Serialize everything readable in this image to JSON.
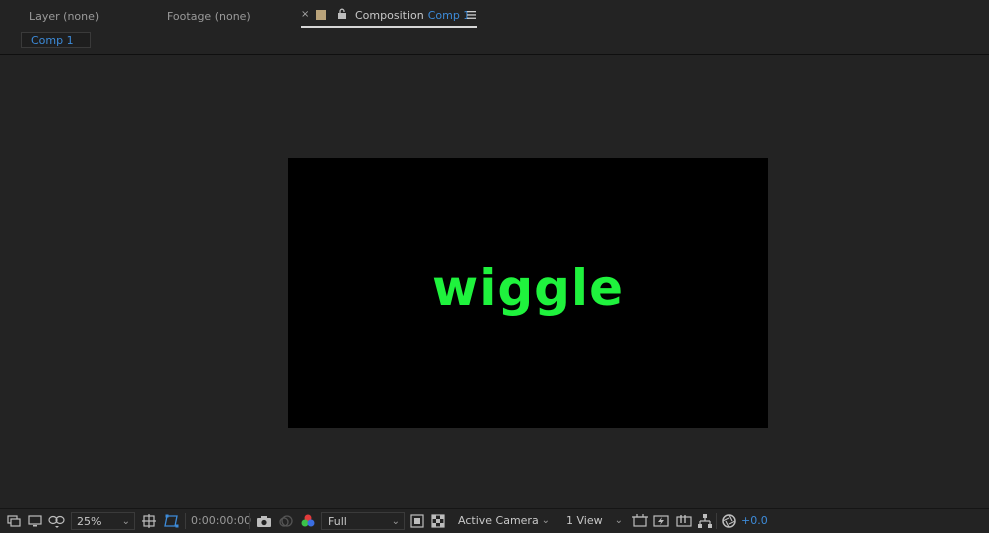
{
  "tabs": {
    "layer": "Layer  (none)",
    "footage": "Footage  (none)",
    "composition_prefix": "Composition",
    "composition_name": "Comp 1",
    "close_glyph": "×"
  },
  "subtab": {
    "label": "Comp 1"
  },
  "composition": {
    "text": "wiggle",
    "background": "#000000",
    "text_color": "#1ff23d"
  },
  "toolbar": {
    "magnification": "25%",
    "timecode": "0:00:00:00",
    "resolution": "Full",
    "camera": "Active Camera",
    "views": "1 View",
    "exposure": "+0.0",
    "dropdown_arrow": "⌄"
  },
  "colors": {
    "panel_bg": "#232323",
    "accent_blue": "#3d8bd9",
    "comp_label_swatch": "#b9a37a"
  }
}
